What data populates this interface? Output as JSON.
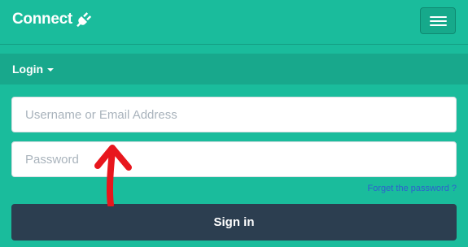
{
  "navbar": {
    "brand": "Connect",
    "brand_icon": "plug-icon",
    "menu_icon": "hamburger-menu-icon"
  },
  "login_header": {
    "label": "Login",
    "caret_icon": "caret-down-icon"
  },
  "form": {
    "username_placeholder": "Username or Email Address",
    "username_value": "",
    "password_placeholder": "Password",
    "password_value": "",
    "forgot_link": "Forget the password ?",
    "signin_label": "Sign in"
  },
  "annotation": {
    "arrow_icon": "red-arrow-up-icon"
  },
  "colors": {
    "background": "#1abc9c",
    "subbar": "#18a88c",
    "button": "#2c3e50",
    "link": "#2f5fcf",
    "annotation": "#e8161d"
  }
}
